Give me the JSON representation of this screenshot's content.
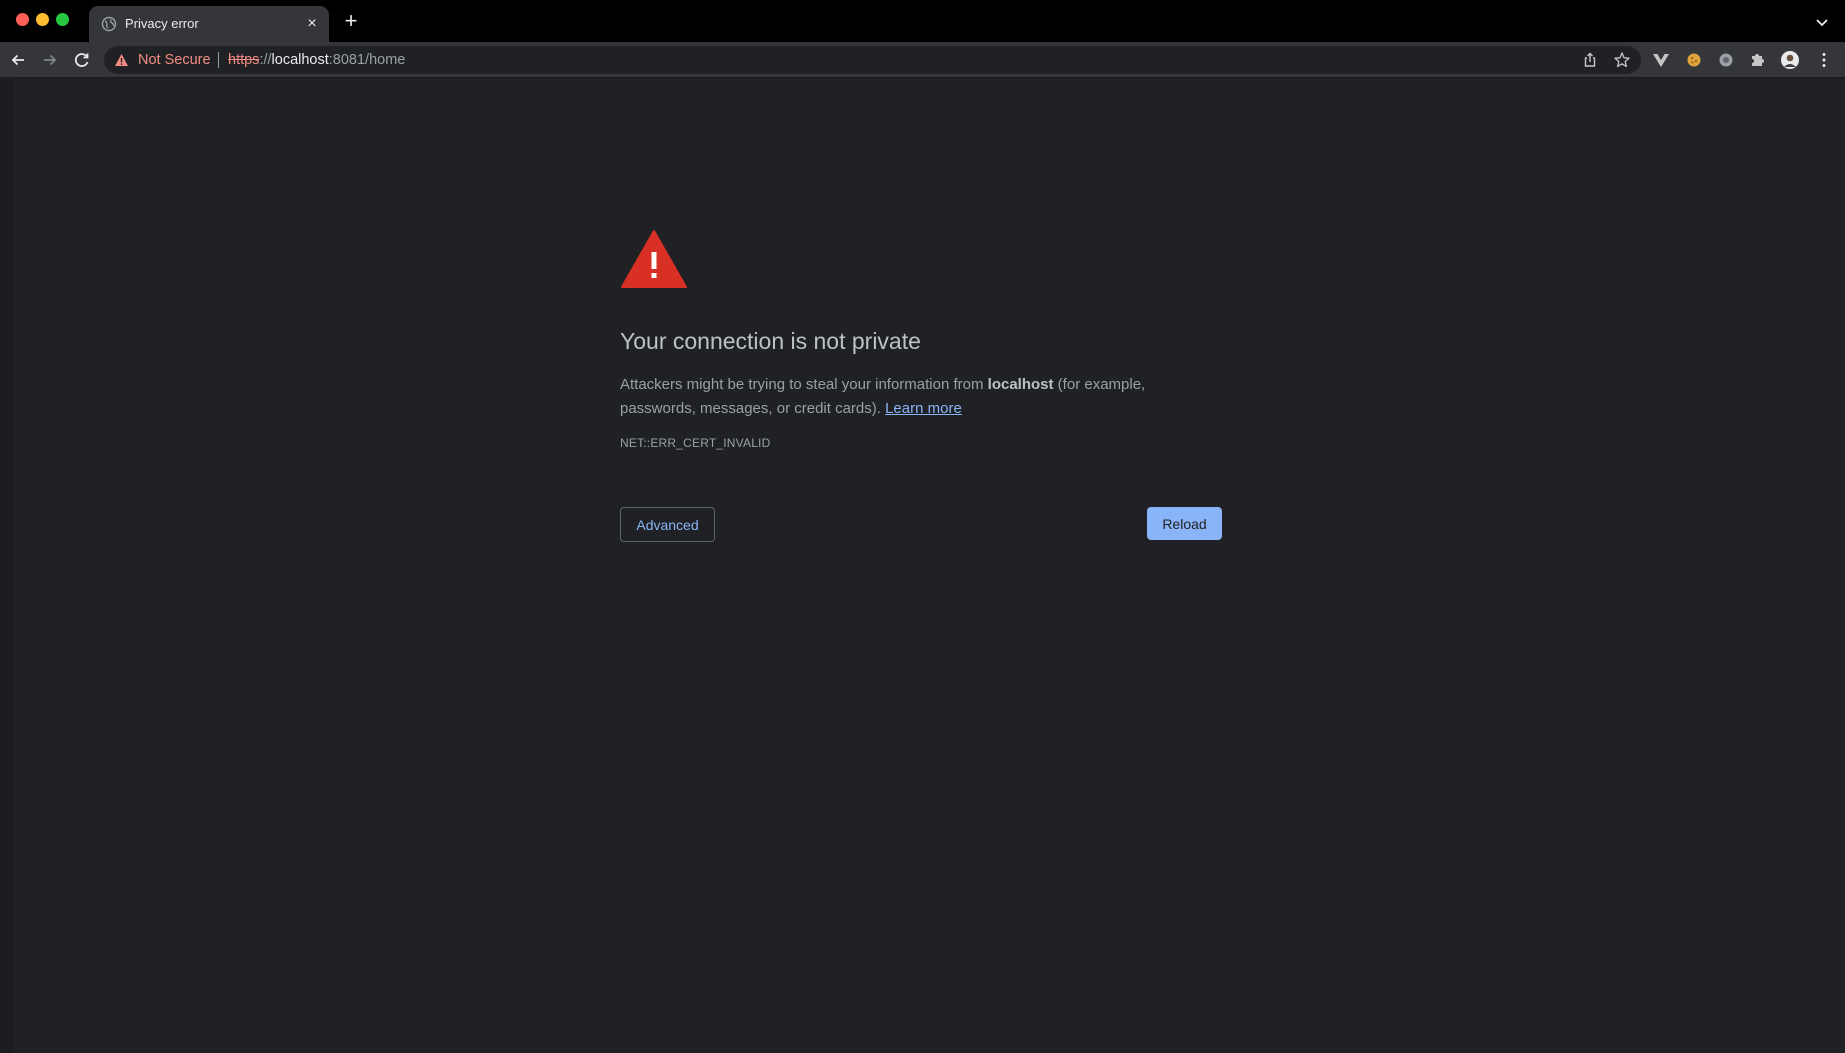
{
  "tab": {
    "title": "Privacy error",
    "close_glyph": "×"
  },
  "newtab_glyph": "+",
  "omnibox": {
    "security_label": "Not Secure",
    "url_scheme": "https",
    "url_sep": "://",
    "url_host": "localhost",
    "url_rest": ":8081/home"
  },
  "interstitial": {
    "heading": "Your connection is not private",
    "body_before": "Attackers might be trying to steal your information from ",
    "body_host": "localhost",
    "body_after": " (for example, passwords, messages, or credit cards). ",
    "learn_more": "Learn more",
    "error_code": "NET::ERR_CERT_INVALID",
    "advanced_label": "Advanced",
    "reload_label": "Reload"
  },
  "colors": {
    "page_bg": "#202124",
    "toolbar_bg": "#35363a",
    "warning_red": "#d93025",
    "link_blue": "#8ab4f8",
    "not_secure_red": "#f28b82"
  }
}
